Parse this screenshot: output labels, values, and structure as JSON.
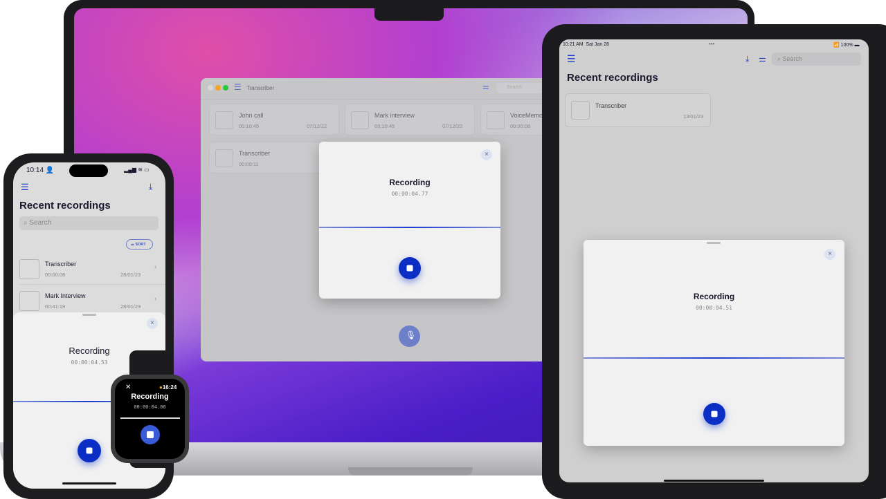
{
  "mac": {
    "app_title": "Transcriber",
    "search_placeholder": "Search",
    "recordings": [
      {
        "title": "John call",
        "duration": "00:10:45",
        "date": "07/12/22"
      },
      {
        "title": "Mark interview",
        "duration": "00:10:45",
        "date": "07/12/22"
      },
      {
        "title": "VoiceMemo",
        "duration": "00:00:08",
        "date": ""
      },
      {
        "title": "Transcriber",
        "duration": "00:00:11",
        "date": "24"
      }
    ],
    "modal": {
      "title": "Recording",
      "timer": "00:00:04.77",
      "close": "×"
    }
  },
  "ipad": {
    "status": {
      "time": "10:21 AM",
      "date": "Sat Jan 28",
      "battery": "100%"
    },
    "heading": "Recent recordings",
    "search_placeholder": "Search",
    "recordings": [
      {
        "title": "Transcriber",
        "date": "13/01/23"
      }
    ],
    "sheet": {
      "title": "Recording",
      "timer": "00:00:04.51",
      "close": "×"
    }
  },
  "iphone": {
    "status": {
      "time": "10:14"
    },
    "heading": "Recent recordings",
    "search_placeholder": "Search",
    "sort_label": "SORT",
    "recordings": [
      {
        "title": "Transcriber",
        "duration": "00:00:08",
        "date": "28/01/23"
      },
      {
        "title": "Mark Interview",
        "duration": "00:41:19",
        "date": "28/01/23"
      }
    ],
    "sheet": {
      "title": "Recording",
      "timer": "00:00:04.53",
      "close": "×"
    }
  },
  "watch": {
    "time": "16:24",
    "title": "Recording",
    "timer": "00:00:04.06",
    "close": "✕"
  },
  "colors": {
    "accent": "#0b2fc4"
  }
}
